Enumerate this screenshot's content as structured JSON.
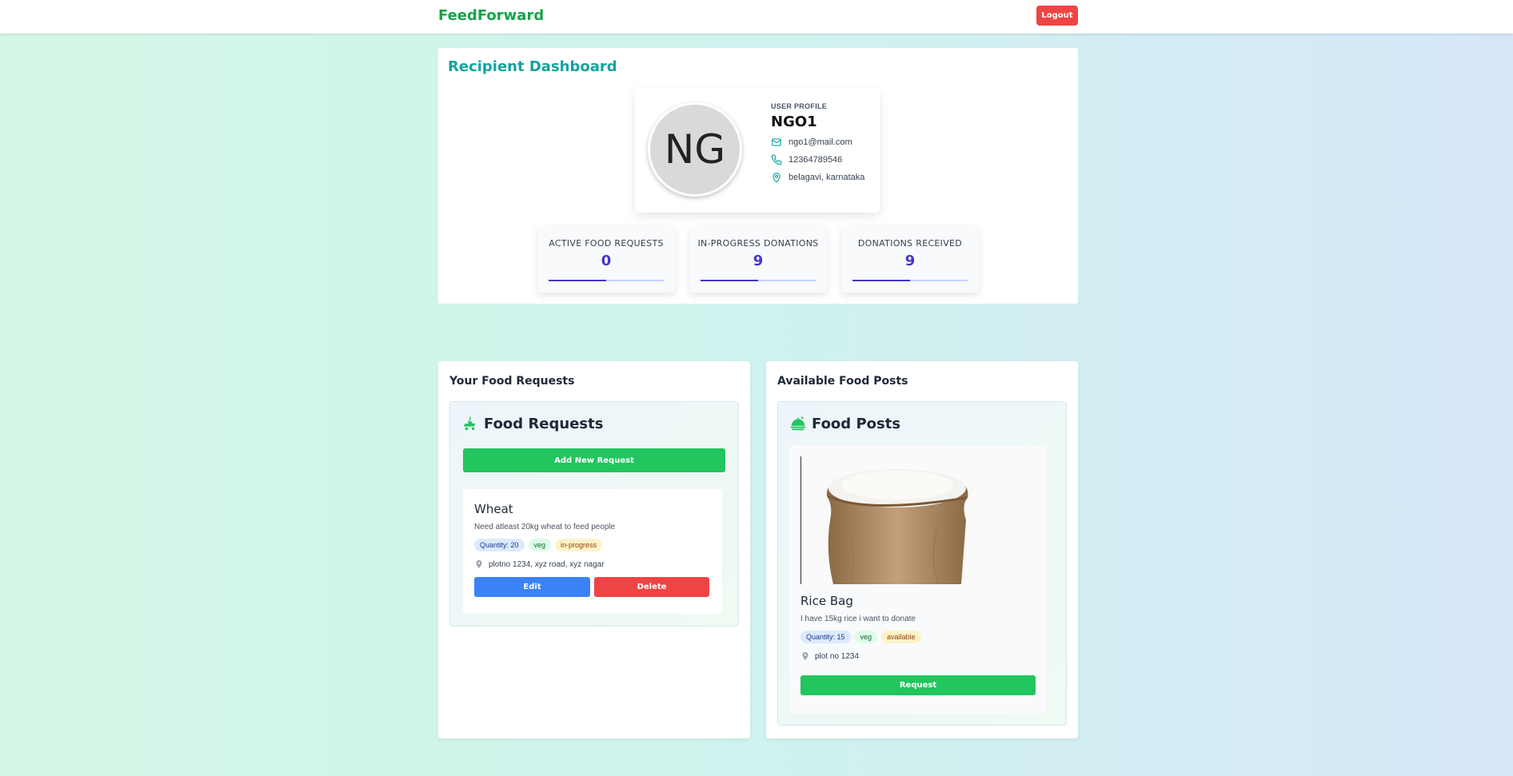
{
  "navbar": {
    "brand": "FeedForward",
    "logout_label": "Logout"
  },
  "dashboard": {
    "title": "Recipient Dashboard",
    "profile": {
      "label": "USER PROFILE",
      "initials": "NG",
      "name": "NGO1",
      "email": "ngo1@mail.com",
      "phone": "12364789546",
      "location": "belagavi, karnataka"
    },
    "stats": [
      {
        "label": "ACTIVE FOOD REQUESTS",
        "value": "0",
        "progress": 0.5
      },
      {
        "label": "IN-PROGRESS DONATIONS",
        "value": "9",
        "progress": 0.5
      },
      {
        "label": "DONATIONS RECEIVED",
        "value": "9",
        "progress": 0.5
      }
    ]
  },
  "requests_panel": {
    "title": "Your Food Requests",
    "heading": "Food Requests",
    "add_label": "Add New Request",
    "items": [
      {
        "title": "Wheat",
        "description": "Need atleast 20kg wheat to feed people",
        "quantity": "Quantity: 20",
        "type": "veg",
        "status": "in-progress",
        "location": "plotno 1234, xyz road, xyz nagar",
        "edit_label": "Edit",
        "delete_label": "Delete"
      }
    ]
  },
  "posts_panel": {
    "title": "Available Food Posts",
    "heading": "Food Posts",
    "items": [
      {
        "title": "Rice Bag",
        "description": "I have 15kg rice i want to donate",
        "quantity": "Quantity: 15",
        "type": "veg",
        "status": "available",
        "location": "plot no 1234",
        "request_label": "Request"
      }
    ]
  },
  "colors": {
    "brand": "#16a34a",
    "accent_teal": "#14a3a0",
    "stat_indigo": "#4338ca",
    "danger": "#ef4444",
    "primary_blue": "#3b82f6",
    "success": "#22c55e"
  },
  "icons": [
    "mail-icon",
    "phone-icon",
    "map-pin-icon",
    "food-delivery-icon",
    "food-tray-icon"
  ]
}
